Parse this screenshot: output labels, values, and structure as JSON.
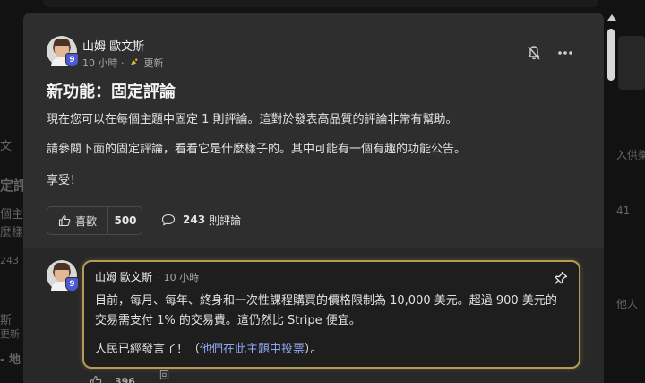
{
  "background": {
    "left_fragments": [
      "文",
      "定評",
      "個主",
      "麼樣",
      "243",
      "斯",
      "更新",
      "- 地"
    ],
    "right_fragments": [
      "入供樂",
      "41",
      "他人"
    ]
  },
  "post": {
    "author": "山姆 歐文斯",
    "level": "9",
    "time": "10 小時",
    "updated_label": "更新",
    "title": "新功能：固定評論",
    "paragraphs": [
      "現在您可以在每個主題中固定 1 則評論。這對於發表高品質的評論非常有幫助。",
      "請參閱下面的固定評論，看看它是什麼樣子的。其中可能有一個有趣的功能公告。",
      "享受！"
    ],
    "like_label": "喜歡",
    "like_count": "500",
    "comment_count": "243",
    "comment_label": "則評論"
  },
  "pinned_comment": {
    "author": "山姆 歐文斯",
    "level": "9",
    "time": "· 10 小時",
    "line1": "目前，每月、每年、終身和一次性課程購買的價格限制為 10,000 美元。超過 900 美元的",
    "line2": "交易需支付 1% 的交易費。這仍然比 Stripe 便宜。",
    "line3_prefix": "人民已經發言了！（",
    "line3_link": "他們在此主題中投票",
    "line3_suffix": "）。"
  },
  "below": {
    "like_count_partial": "396",
    "reply_fragment": "回"
  },
  "colors": {
    "accent_gold": "#b79a55",
    "level_badge": "#4a5bd4",
    "link": "#8fa8f0"
  }
}
